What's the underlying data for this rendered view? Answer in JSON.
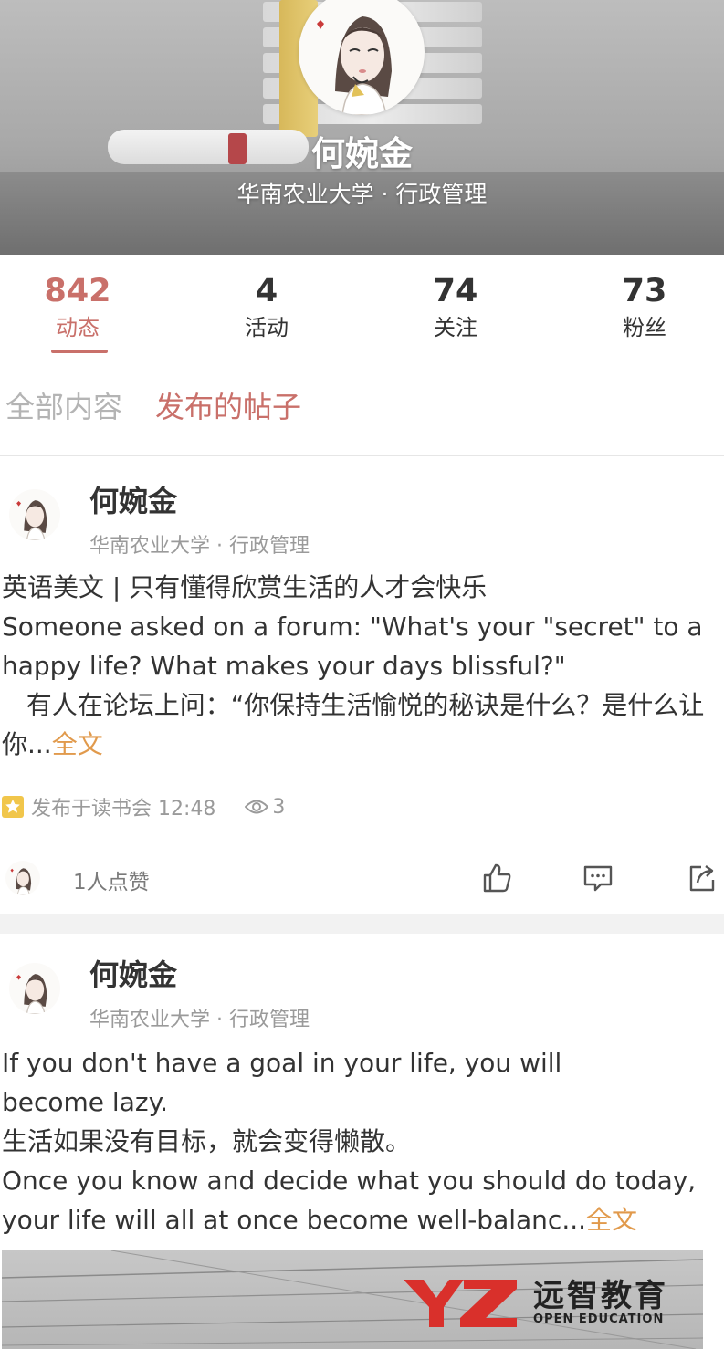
{
  "profile": {
    "name": "何婉金",
    "school": "华南农业大学 · 行政管理"
  },
  "stats": [
    {
      "value": "842",
      "label": "动态",
      "active": true
    },
    {
      "value": "4",
      "label": "活动",
      "active": false
    },
    {
      "value": "74",
      "label": "关注",
      "active": false
    },
    {
      "value": "73",
      "label": "粉丝",
      "active": false
    }
  ],
  "filters": {
    "all": "全部内容",
    "posts": "发布的帖子"
  },
  "posts": [
    {
      "author": "何婉金",
      "school": "华南农业大学 · 行政管理",
      "body": "英语美文 | 只有懂得欣赏生活的人才会快乐\nSomeone asked on a forum: \"What's your \"secret\" to a happy life? What makes your days blissful?\"\n   有人在论坛上问：“你保持生活愉悦的秘诀是什么？是什么让你...",
      "more_label": "全文",
      "published": "发布于读书会 12:48",
      "views": "3",
      "likes_text": "1人点赞"
    },
    {
      "author": "何婉金",
      "school": "华南农业大学 · 行政管理",
      "body": "If you don't have a goal in your life, you will\nbecome lazy.\n生活如果没有目标，就会变得懒散。\nOnce you know and decide what you should do today, your life will all at once become well-balanc...",
      "more_label": "全文"
    }
  ],
  "watermark": {
    "logo": "YZ",
    "cn": "远智教育",
    "en": "OPEN EDUCATION"
  },
  "colors": {
    "accent": "#c9706a",
    "link": "#e19a4c",
    "muted": "#9a9a9a",
    "watermark_red": "#d9302b"
  }
}
